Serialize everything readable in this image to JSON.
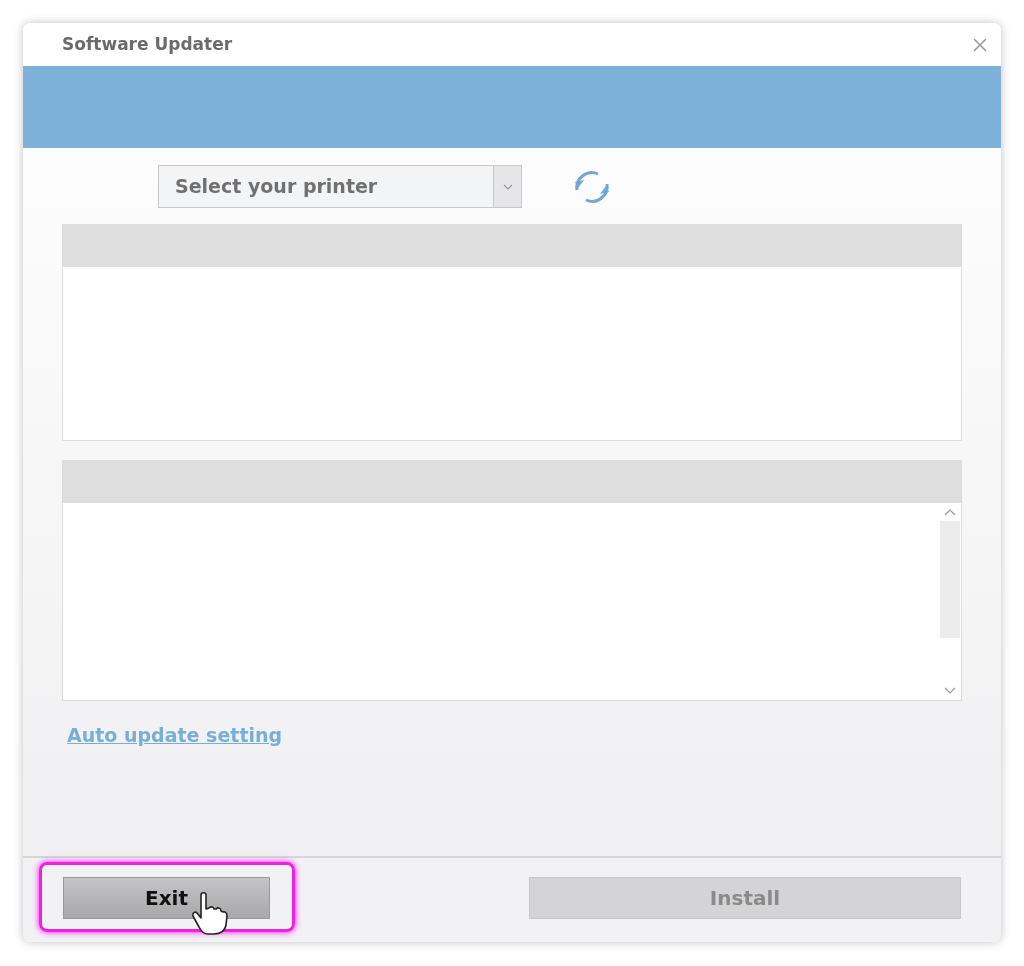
{
  "window": {
    "title": "Software Updater"
  },
  "printer_select": {
    "placeholder": "Select your printer"
  },
  "auto_update_link": "Auto update setting",
  "buttons": [
    {
      "label": "Exit",
      "kind": "exit",
      "disabled": false,
      "highlighted": true
    },
    {
      "label": "Install",
      "kind": "install",
      "disabled": true,
      "highlighted": false
    }
  ]
}
